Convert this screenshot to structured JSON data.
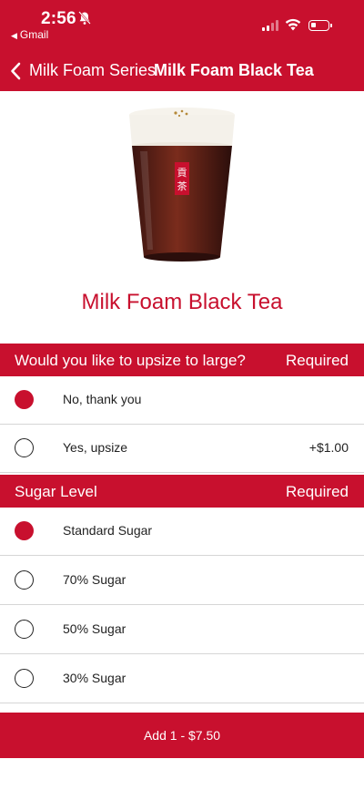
{
  "status_bar": {
    "time": "2:56",
    "back_app": "Gmail"
  },
  "nav": {
    "back_label": "Milk Foam Series",
    "title": "Milk Foam Black Tea"
  },
  "product": {
    "name": "Milk Foam Black Tea",
    "image_icon": "milk-foam-black-tea-cup"
  },
  "sections": [
    {
      "title": "Would you like to upsize to large?",
      "required_label": "Required",
      "options": [
        {
          "label": "No, thank you",
          "price": "",
          "selected": true
        },
        {
          "label": "Yes, upsize",
          "price": "+$1.00",
          "selected": false
        }
      ]
    },
    {
      "title": "Sugar Level",
      "required_label": "Required",
      "options": [
        {
          "label": "Standard Sugar",
          "selected": true
        },
        {
          "label": "70% Sugar",
          "selected": false
        },
        {
          "label": "50% Sugar",
          "selected": false
        },
        {
          "label": "30% Sugar",
          "selected": false
        }
      ]
    }
  ],
  "add_button": {
    "label": "Add 1 - $7.50"
  },
  "colors": {
    "brand": "#c8102e",
    "text": "#222222",
    "divider": "#d6d6d6"
  }
}
